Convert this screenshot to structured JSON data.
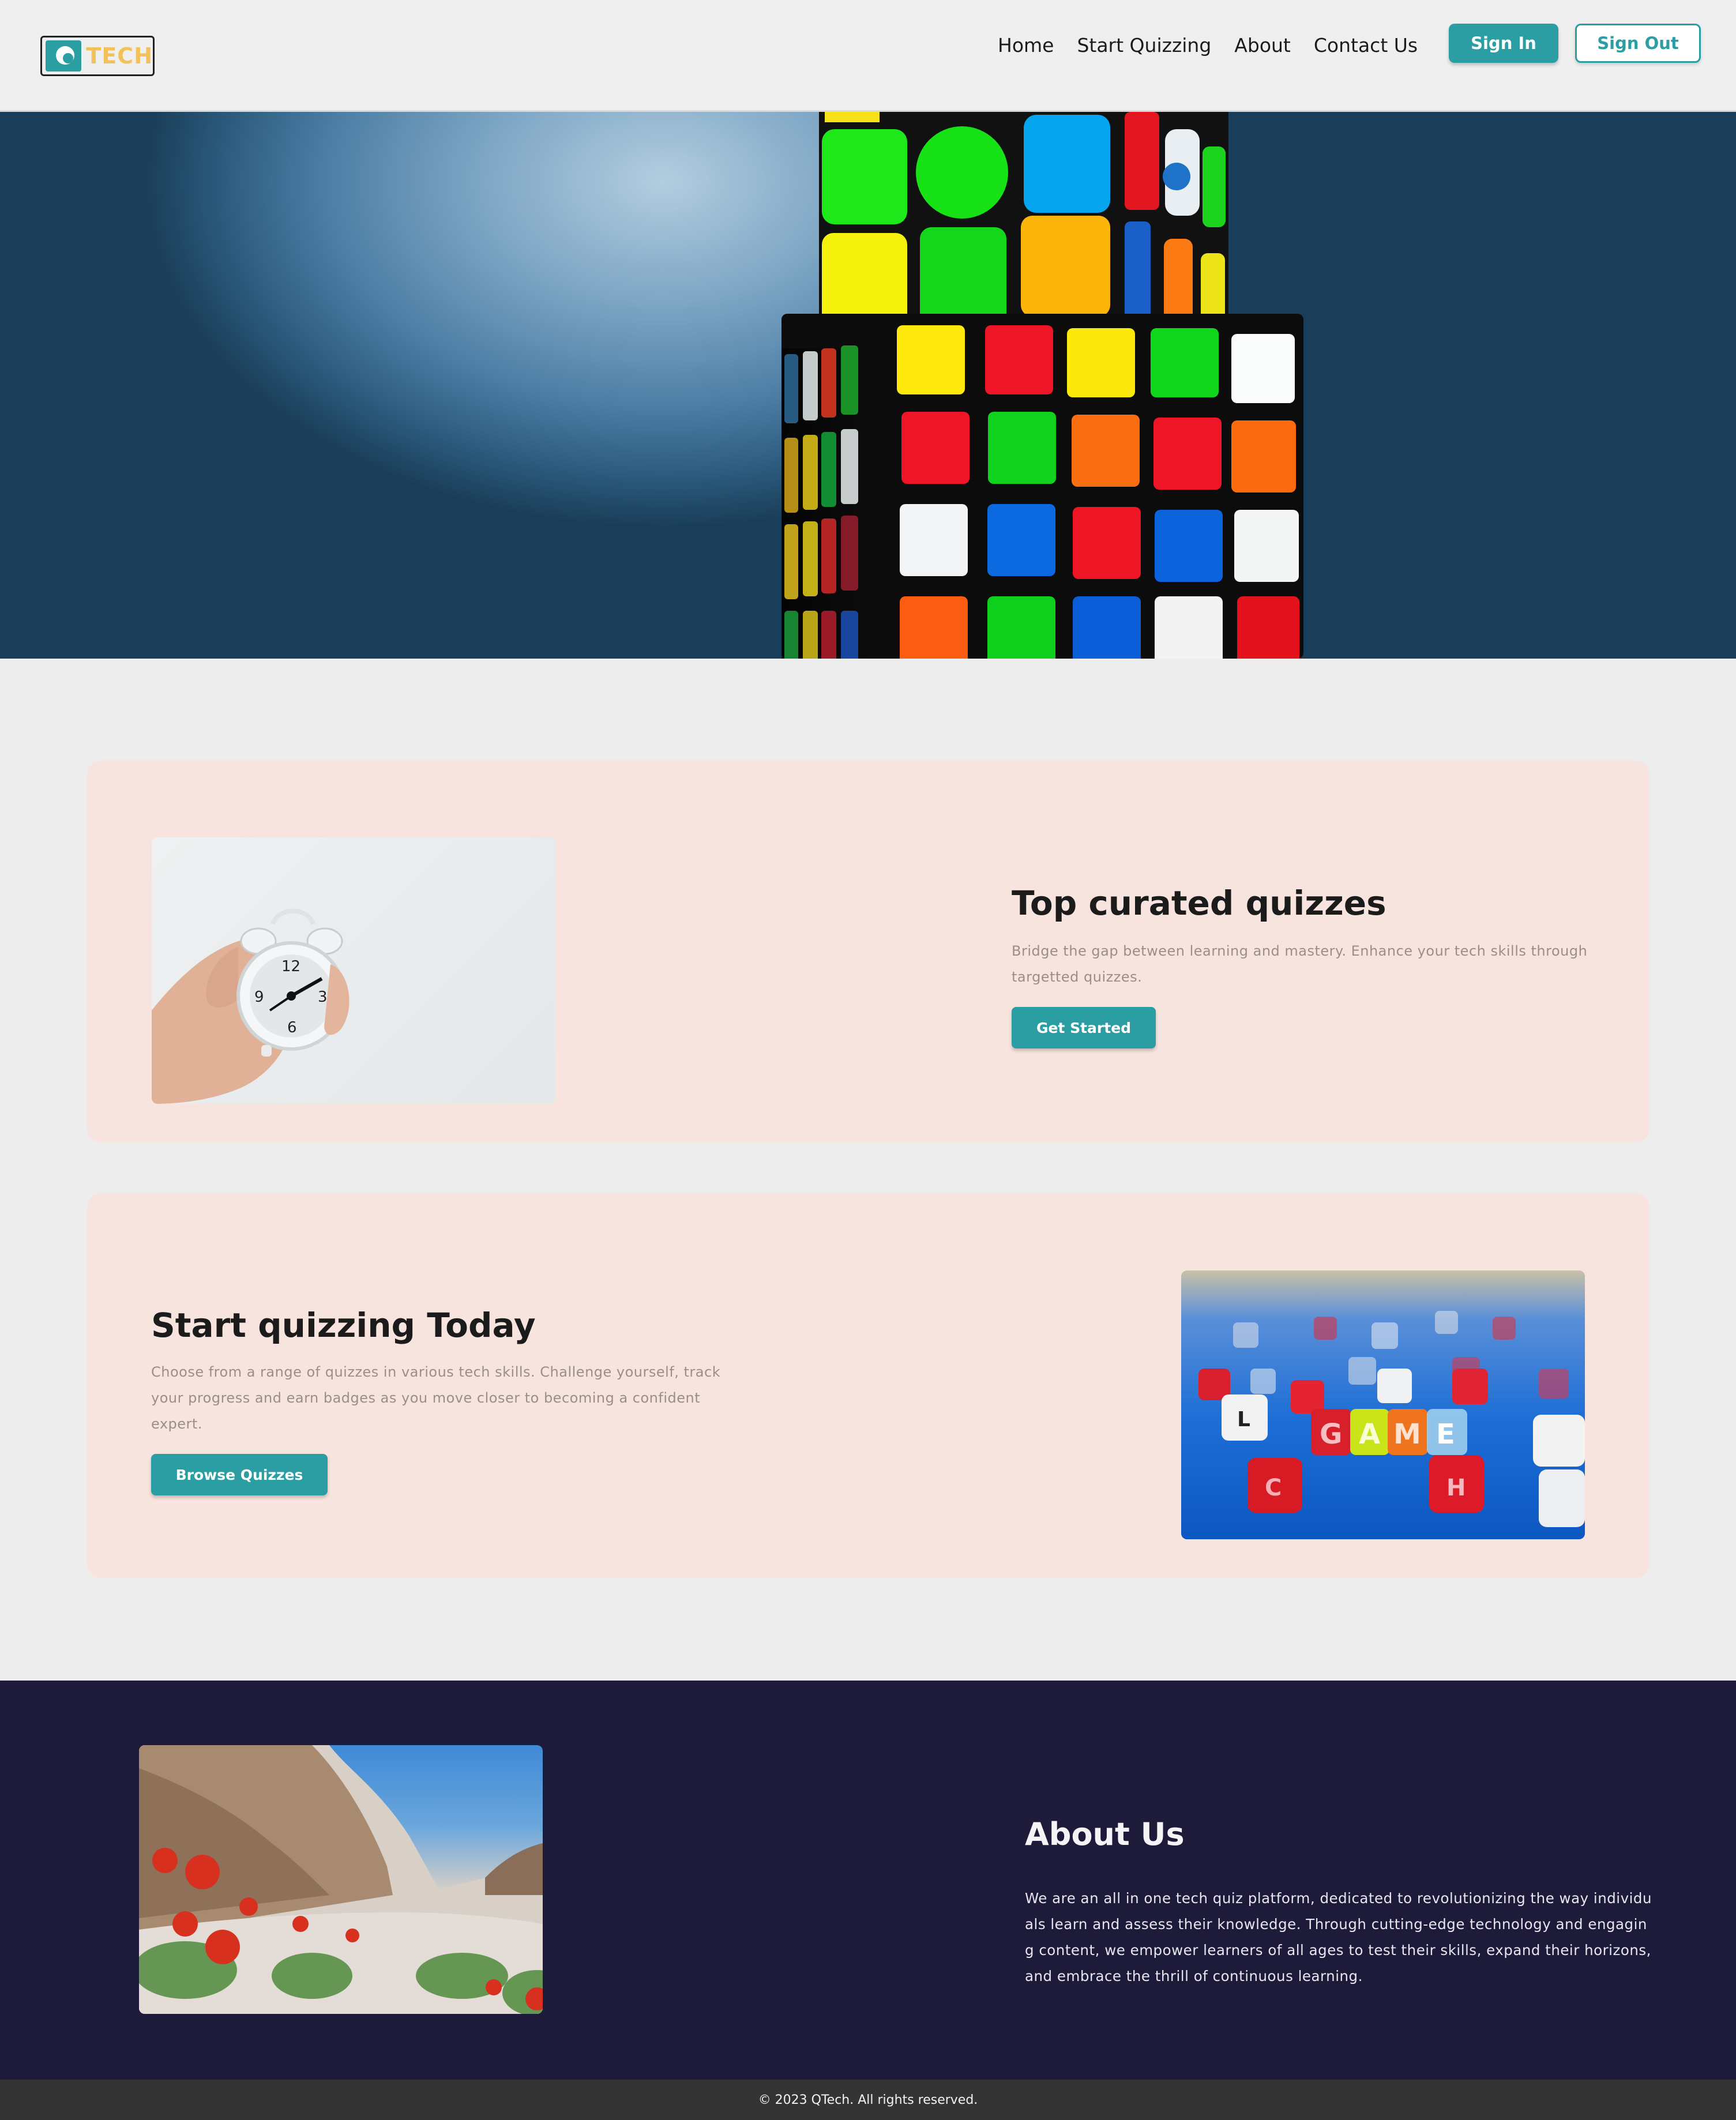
{
  "brand": {
    "logo_text": "TECH"
  },
  "nav": {
    "links": [
      "Home",
      "Start Quizzing",
      "About",
      "Contact Us"
    ],
    "sign_in": "Sign In",
    "sign_out": "Sign Out"
  },
  "hero": {
    "image": "rubiks-cube-photo"
  },
  "sections": [
    {
      "title": "Top curated quizzes",
      "text": "Bridge the gap between learning and mastery. Enhance your tech skills through targetted quizzes.",
      "button": "Get Started",
      "image": "alarm-clock-in-hand-photo"
    },
    {
      "title": "Start quizzing Today",
      "text": "Choose from a range of quizzes in various tech skills. Challenge yourself, track your progress and earn badges as you move closer to becoming a confident expert.",
      "button": "Browse Quizzes",
      "image": "game-letter-dice-photo",
      "dice_letters": [
        "G",
        "A",
        "M",
        "E",
        "L",
        "C",
        "H"
      ]
    }
  ],
  "about": {
    "title": "About Us",
    "text": "We are an all in one tech quiz platform, dedicated to revolutionizing the way individuals learn and assess their knowledge. Through cutting-edge technology and engaging content, we empower learners of all ages to test their skills, expand their horizons, and embrace the thrill of continuous learning.",
    "image": "desert-poppies-photo"
  },
  "footer": {
    "copyright": "© 2023 QTech. All rights reserved."
  },
  "colors": {
    "accent": "#2a9ea3",
    "card_bg": "#f8e4de",
    "about_bg": "#1e1b3a",
    "footer_bg": "#343434",
    "logo_text": "#f3c15a"
  }
}
